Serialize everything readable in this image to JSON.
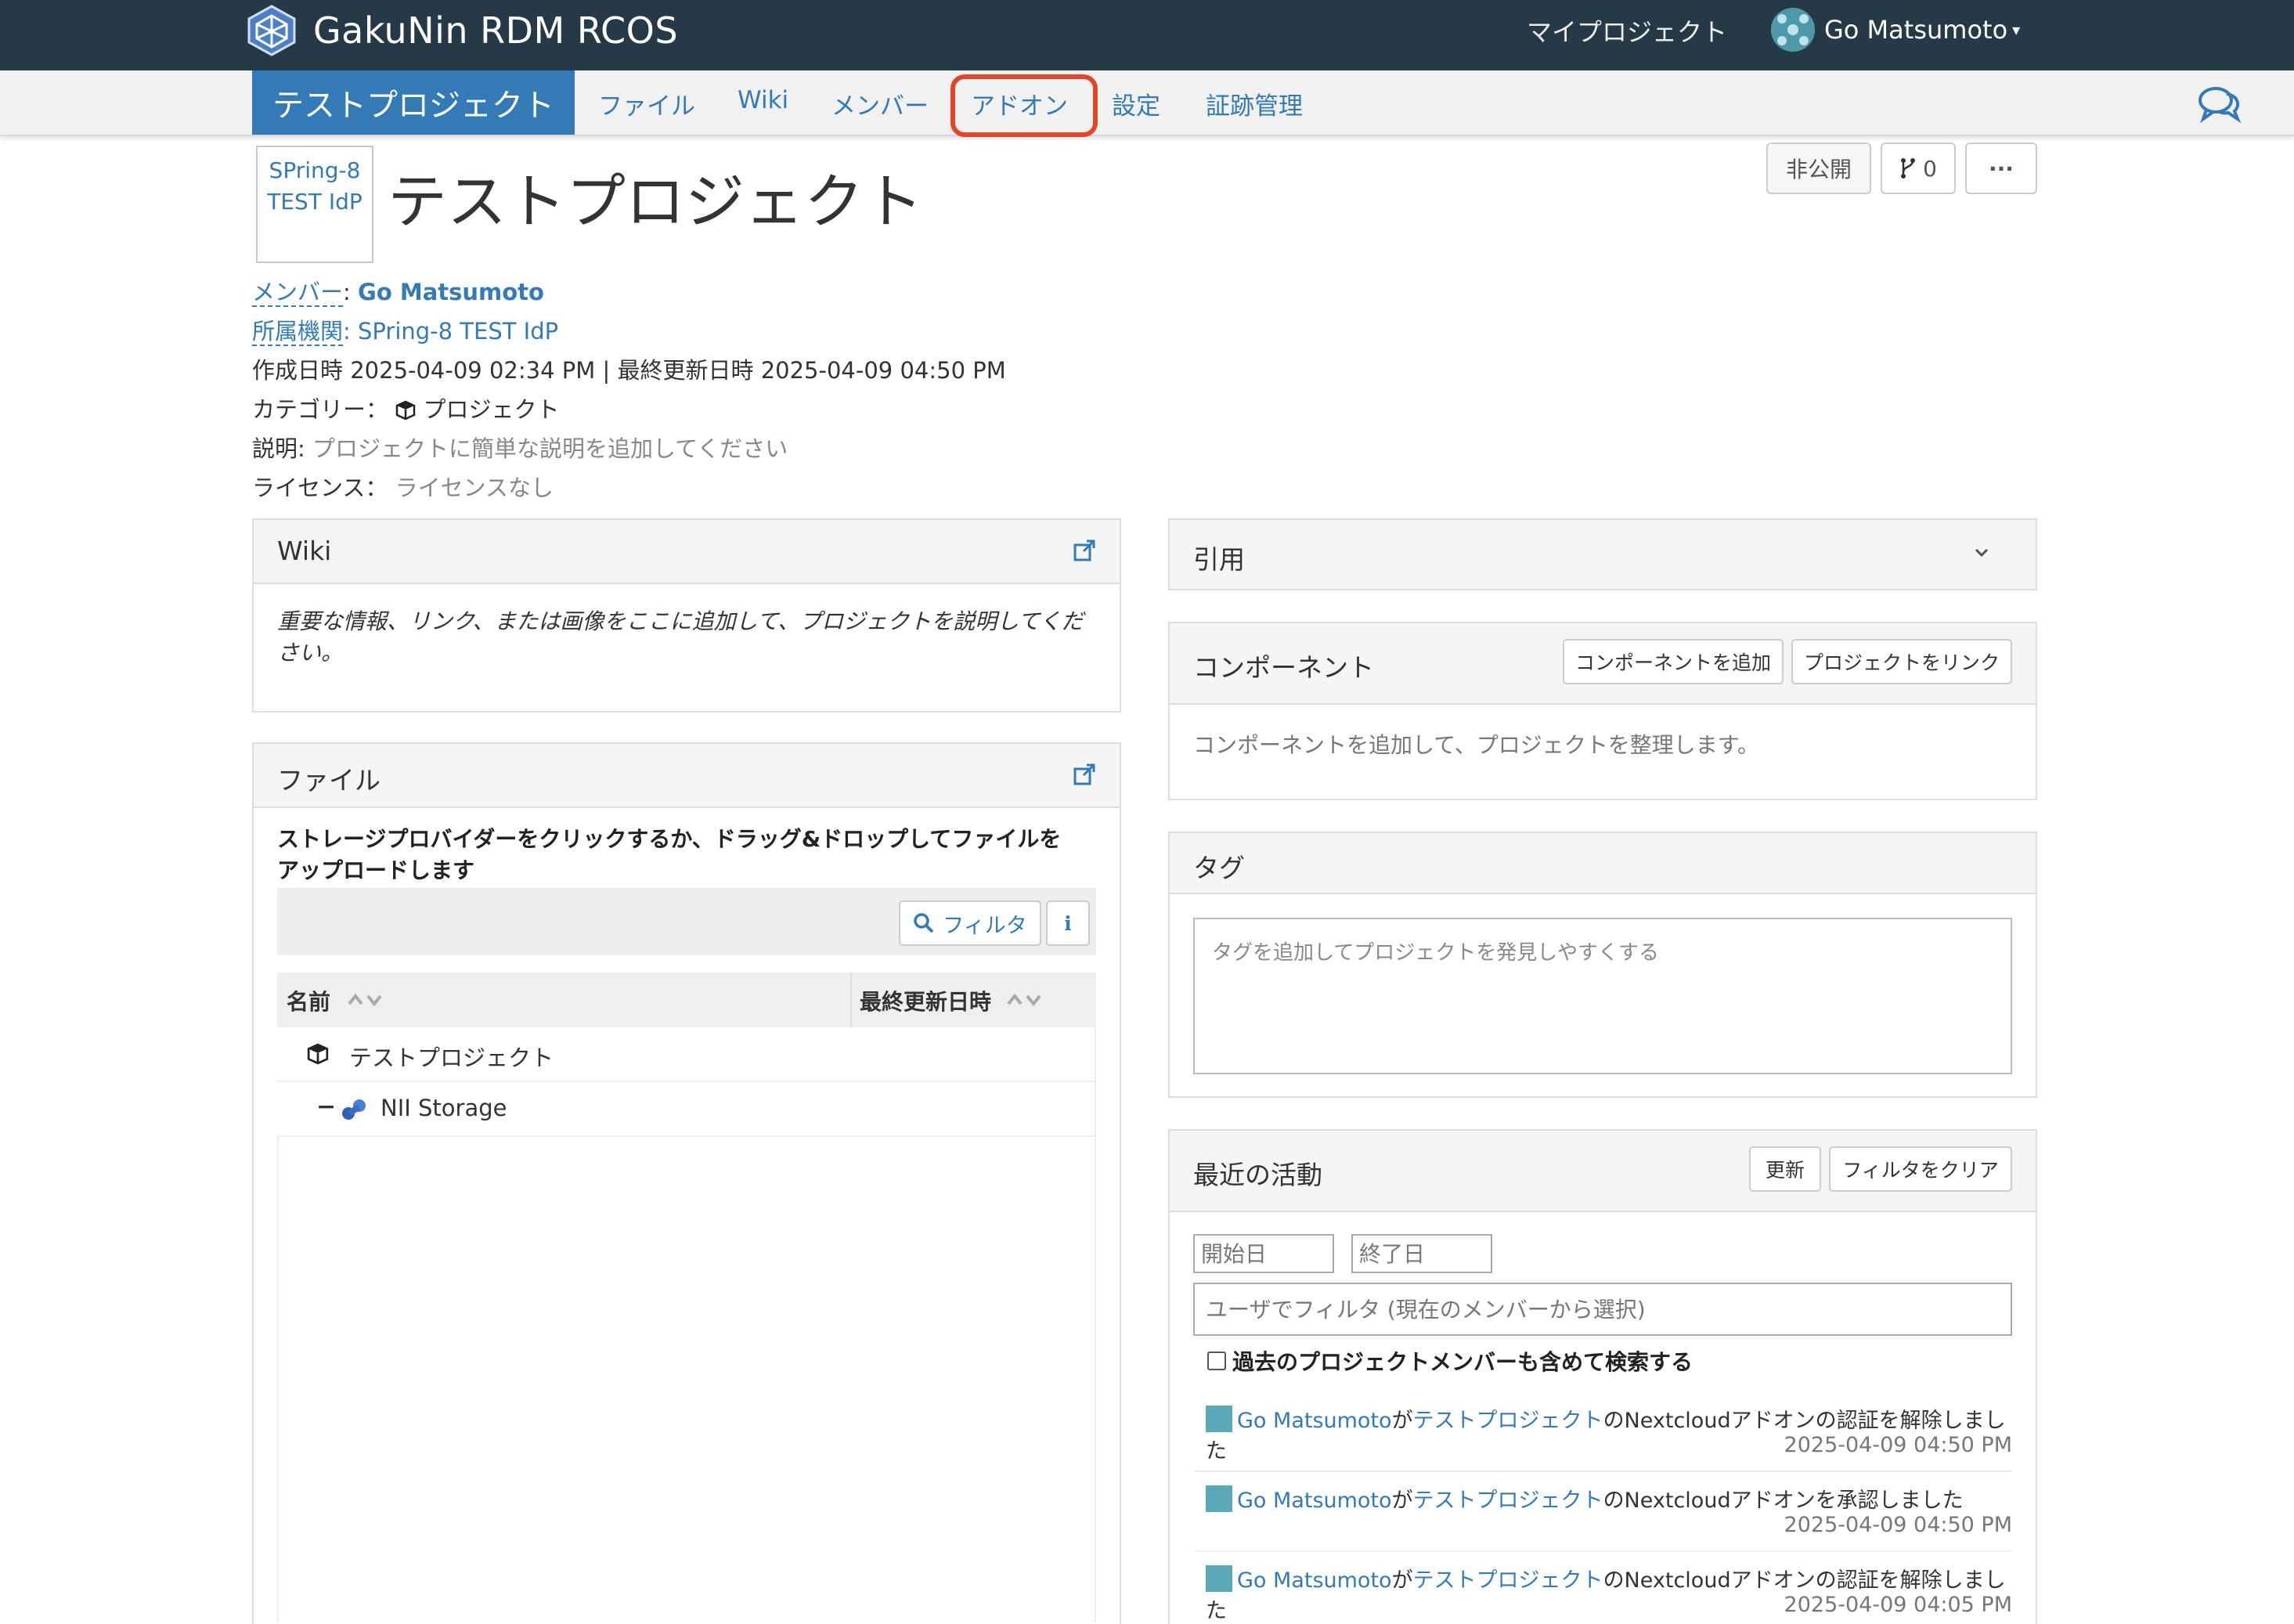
{
  "brand": {
    "name": "GakuNin RDM RCOS",
    "logo_icon": "gakunin-logo-icon"
  },
  "topnav": {
    "my_projects": "マイプロジェクト",
    "user_name": "Go Matsumoto",
    "caret": "▾"
  },
  "projnav": {
    "title": "テストプロジェクト",
    "items": [
      "ファイル",
      "Wiki",
      "メンバー",
      "アドオン",
      "設定",
      "証跡管理"
    ],
    "highlighted": "アドオン"
  },
  "header": {
    "institution_logo_alt": "SPring-8 TEST IdP",
    "title": "テストプロジェクト",
    "visibility": "非公開",
    "forks_icon": "fork-icon",
    "forks_count": "0",
    "more": "···"
  },
  "meta": {
    "members_label": "メンバー",
    "members_value": "Go Matsumoto",
    "affiliation_label": "所属機関",
    "affiliation_value": "SPring-8 TEST IdP",
    "dates": "作成日時 2025-04-09 02:34 PM | 最終更新日時 2025-04-09 04:50 PM",
    "category_label": "カテゴリー：",
    "category_value": "プロジェクト",
    "description_label": "説明:",
    "description_value": "プロジェクトに簡単な説明を追加してください",
    "license_label": "ライセンス：",
    "license_value": "ライセンスなし"
  },
  "wiki_panel": {
    "title": "Wiki",
    "body": "重要な情報、リンク、または画像をここに追加して、プロジェクトを説明してください。"
  },
  "files_panel": {
    "title": "ファイル",
    "instruction": "ストレージプロバイダーをクリックするか、ドラッグ&ドロップしてファイルをアップロードします",
    "filter_label": "フィルタ",
    "info_label": "i",
    "columns": {
      "name": "名前",
      "modified": "最終更新日時"
    },
    "rows": [
      {
        "label": "テストプロジェクト",
        "icon": "cube-icon"
      },
      {
        "label": "NII Storage",
        "icon": "nii-storage-icon",
        "toggle": "−"
      }
    ]
  },
  "citation_panel": {
    "title": "引用",
    "chevron": "⌄"
  },
  "components_panel": {
    "title": "コンポーネント",
    "add_button": "コンポーネントを追加",
    "link_button": "プロジェクトをリンク",
    "body": "コンポーネントを追加して、プロジェクトを整理します。"
  },
  "tags_panel": {
    "title": "タグ",
    "placeholder": "タグを追加してプロジェクトを発見しやすくする"
  },
  "activity_panel": {
    "title": "最近の活動",
    "refresh_button": "更新",
    "clear_filter_button": "フィルタをクリア",
    "start_date_placeholder": "開始日",
    "end_date_placeholder": "終了日",
    "user_filter_placeholder": "ユーザでフィルタ (現在のメンバーから選択)",
    "include_past_members": "過去のプロジェクトメンバーも含めて検索する",
    "items": [
      {
        "user": "Go Matsumoto",
        "ga": "が",
        "project": "テストプロジェクト",
        "action": "のNextcloudアドオンの認証を解除しました",
        "time": "2025-04-09 04:50 PM"
      },
      {
        "user": "Go Matsumoto",
        "ga": "が",
        "project": "テストプロジェクト",
        "action": "のNextcloudアドオンを承認しました",
        "time": "2025-04-09 04:50 PM"
      },
      {
        "user": "Go Matsumoto",
        "ga": "が",
        "project": "テストプロジェクト",
        "action": "のNextcloudアドオンの認証を解除しました",
        "time": "2025-04-09 04:05 PM"
      }
    ]
  },
  "colors": {
    "navbar": "#263947",
    "accent": "#337ab7",
    "highlight": "#e04628"
  }
}
